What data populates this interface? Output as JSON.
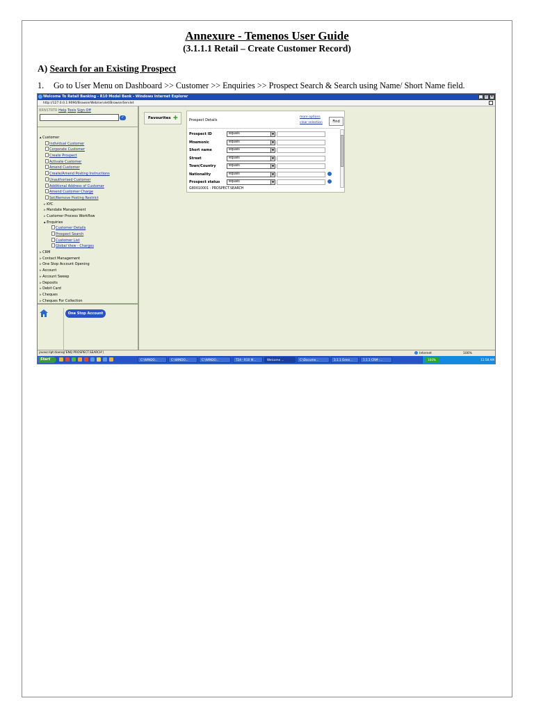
{
  "document": {
    "title": "Annexure - Temenos User Guide",
    "subtitle": "(3.1.1.1 Retail – Create Customer Record)",
    "section_prefix": "A)",
    "section_title": "Search for an Existing Prospect",
    "step_number": "1.",
    "step_text": "Go to User Menu on Dashboard >> Customer >> Enquiries >> Prospect Search & Search using Name/ Short Name field."
  },
  "browser": {
    "window_title": "Welcome To Retail Banking - R10 Model Bank - Windows Internet Explorer",
    "address": "http://127.0.0.1:9090/BrowserWeb/servlet/BrowserServlet",
    "status_text": "javascript:doenq('ENQ PROSPECT.SEARCH')",
    "zone": "Internet",
    "zoom": "100%"
  },
  "sidebar": {
    "user_label": "BRNSTRTR",
    "links": [
      "Help",
      "Tools",
      "Sign Off"
    ],
    "menu": [
      {
        "text": "Customer",
        "level": 0,
        "prefix": "▴",
        "link": false
      },
      {
        "text": "Individual Customer",
        "level": 1,
        "link": true
      },
      {
        "text": "Corporate Customer",
        "level": 1,
        "link": true
      },
      {
        "text": "Create Prospect",
        "level": 1,
        "link": true
      },
      {
        "text": "Activate Customer",
        "level": 1,
        "link": true
      },
      {
        "text": "Amend Customer",
        "level": 1,
        "link": true
      },
      {
        "text": "Create/Amend Posting Instructions",
        "level": 1,
        "link": true
      },
      {
        "text": "Unauthorised Customer",
        "level": 1,
        "link": true
      },
      {
        "text": "Additional Address of Customer",
        "level": 1,
        "link": true
      },
      {
        "text": "Amend Customer Charge",
        "level": 1,
        "link": true
      },
      {
        "text": "Set/Remove Posting Restrict",
        "level": 1,
        "link": true
      },
      {
        "text": "KYC",
        "level": 1,
        "prefix": "▹",
        "link": false
      },
      {
        "text": "Mandate Management",
        "level": 1,
        "prefix": "▹",
        "link": false
      },
      {
        "text": "Customer Process Workflow",
        "level": 1,
        "prefix": "▹",
        "link": false
      },
      {
        "text": "Enquiries",
        "level": 1,
        "prefix": "▴",
        "link": false
      },
      {
        "text": "Customer Details",
        "level": 2,
        "link": true
      },
      {
        "text": "Prospect Search",
        "level": 2,
        "link": true
      },
      {
        "text": "Customer List",
        "level": 2,
        "link": true
      },
      {
        "text": "Global View - Charges",
        "level": 2,
        "link": true
      },
      {
        "text": "CRM",
        "level": 0,
        "prefix": "▹",
        "link": false
      },
      {
        "text": "Contact Management",
        "level": 0,
        "prefix": "▹",
        "link": false
      },
      {
        "text": "One Stop Account Opening",
        "level": 0,
        "prefix": "▹",
        "link": false
      },
      {
        "text": "Account",
        "level": 0,
        "prefix": "▹",
        "link": false
      },
      {
        "text": "Account Sweep",
        "level": 0,
        "prefix": "▹",
        "link": false
      },
      {
        "text": "Deposits",
        "level": 0,
        "prefix": "▹",
        "link": false
      },
      {
        "text": "Debit Card",
        "level": 0,
        "prefix": "▹",
        "link": false
      },
      {
        "text": "Cheques",
        "level": 0,
        "prefix": "▹",
        "link": false
      },
      {
        "text": "Cheques For Collection",
        "level": 0,
        "prefix": "▹",
        "link": false
      }
    ],
    "one_stop_button": "One Stop Account"
  },
  "favourites": {
    "label": "Favourites"
  },
  "prospect_panel": {
    "title": "Prospect Details",
    "more_options": "more options",
    "clear_selection": "clear selection",
    "find_button": "Find",
    "criteria": [
      {
        "label": "Prospect ID",
        "operator": "equals",
        "info": false
      },
      {
        "label": "Mnemonic",
        "operator": "equals",
        "info": false
      },
      {
        "label": "Short name",
        "operator": "equals",
        "info": false
      },
      {
        "label": "Street",
        "operator": "equals",
        "info": false
      },
      {
        "label": "Town/Country",
        "operator": "equals",
        "info": false
      },
      {
        "label": "Nationality",
        "operator": "equals",
        "info": true
      },
      {
        "label": "Prospect status",
        "operator": "equals",
        "info": true
      }
    ],
    "footer": "G80010001 : PROSPECT.SEARCH"
  },
  "taskbar": {
    "start_label": "Start",
    "items": [
      "C:\\WINDO...",
      "C:\\WINDO...",
      "C:\\WINDO...",
      "T24 - R10 M...",
      "Welcome ...",
      "C:\\Docume...",
      "3.1.1 Gene...",
      "1.1.1 CRM -..."
    ],
    "active_index": 4,
    "tray_percent": "100%",
    "clock": "11:58 AM"
  }
}
